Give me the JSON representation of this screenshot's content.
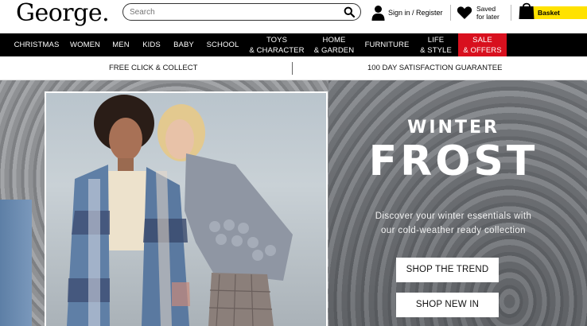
{
  "header": {
    "logo": "George.",
    "search": {
      "placeholder": "Search",
      "value": ""
    },
    "account_label": "Sign in / Register",
    "saved": {
      "line1": "Saved",
      "line2": "for later"
    },
    "basket_label": "Basket"
  },
  "nav": {
    "items": [
      {
        "label": "CHRISTMAS"
      },
      {
        "label": "WOMEN"
      },
      {
        "label": "MEN"
      },
      {
        "label": "KIDS"
      },
      {
        "label": "BABY"
      },
      {
        "label": "SCHOOL"
      },
      {
        "label": "TOYS\n& CHARACTER"
      },
      {
        "label": "HOME\n& GARDEN"
      },
      {
        "label": "FURNITURE"
      },
      {
        "label": "LIFE\n& STYLE"
      },
      {
        "label": "SALE\n& OFFERS"
      }
    ],
    "sale_color": "#d8101e"
  },
  "promo": {
    "left": "FREE CLICK & COLLECT",
    "right": "100 DAY SATISFACTION GUARANTEE"
  },
  "hero": {
    "headline_small": "WINTER",
    "headline_large": "FROST",
    "subcopy_line1": "Discover your winter essentials with",
    "subcopy_line2": "our cold-weather ready collection",
    "cta_primary": "SHOP THE TREND",
    "cta_secondary": "SHOP NEW IN"
  },
  "colors": {
    "basket_accent": "#ffe200",
    "nav_background": "#000000",
    "hero_background": "#8d9094"
  },
  "icons": [
    "search-icon",
    "user-icon",
    "heart-icon",
    "shopping-bag-icon"
  ]
}
